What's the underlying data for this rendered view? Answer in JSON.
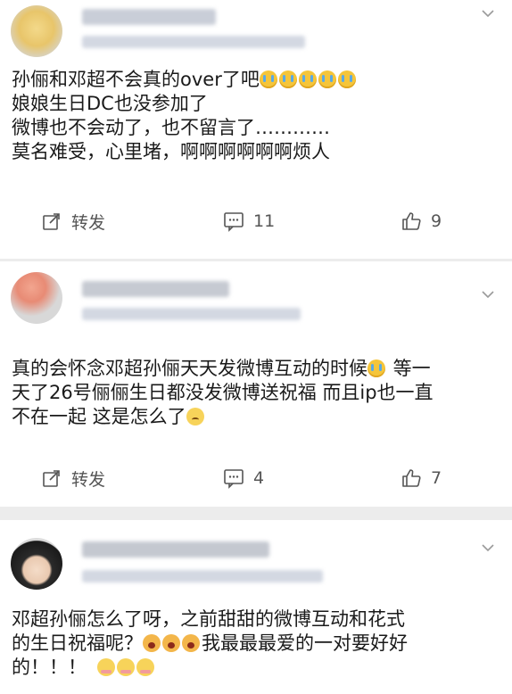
{
  "posts": [
    {
      "lines": [
        "孙俪和邓超不会真的over了吧",
        "娘娘生日DC也没参加了",
        "微博也不会动了，也不留言了…………",
        "莫名难受，心里堵，啊啊啊啊啊啊烦人"
      ],
      "emojis_line1": [
        "crying-emoji",
        "crying-emoji",
        "crying-emoji",
        "crying-emoji",
        "crying-emoji"
      ],
      "actions": {
        "repost": "转发",
        "comment_count": "11",
        "like_count": "9"
      }
    },
    {
      "line1": "真的会怀念邓超孙俪天天发微博互动的时候",
      "line1_tail": " 等一",
      "line2": "天了26号俪俪生日都没发微博送祝福 而且ip也一直",
      "line3": "不在一起 这是怎么了",
      "actions": {
        "repost": "转发",
        "comment_count": "4",
        "like_count": "7"
      }
    },
    {
      "line1": "邓超孙俪怎么了呀，之前甜甜的微博互动和花式",
      "line2_head": "的生日祝福呢？",
      "line2_tail": "我最最最爱的一对要好好",
      "line3": "的！！！"
    }
  ],
  "colors": {
    "text": "#1a1a1a",
    "muted": "#555555",
    "background": "#ececec",
    "card": "#ffffff"
  }
}
